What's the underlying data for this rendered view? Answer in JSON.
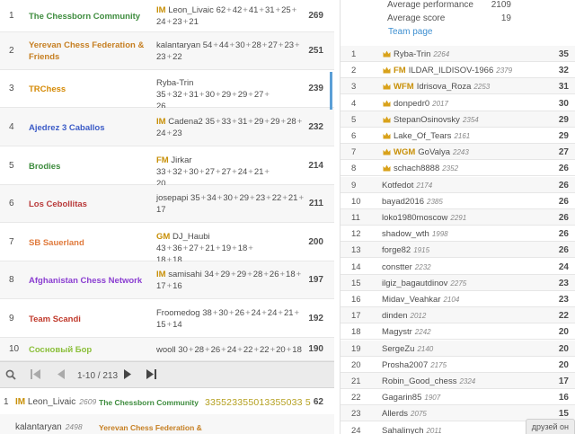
{
  "teams": [
    {
      "rank": "1",
      "name": "The Chessborn Community",
      "color": "#3e8c3e",
      "title": "IM",
      "player": "Leon_Livaic",
      "line1": [
        "62",
        "42",
        "41",
        "31",
        "25"
      ],
      "line2": [
        "24",
        "23",
        "21"
      ],
      "score": "269"
    },
    {
      "rank": "2",
      "name": "Yerevan Chess Federation & Friends",
      "color": "#c67f22",
      "title": "",
      "player": "kalantaryan",
      "line1": [
        "54",
        "44",
        "30",
        "28",
        "27",
        "23"
      ],
      "line2": [
        "23",
        "22"
      ],
      "score": "251"
    },
    {
      "rank": "3",
      "name": "TRChess",
      "color": "#d58a06",
      "title": "",
      "player": "Ryba-Trin",
      "line1": [
        "35",
        "32",
        "31",
        "30",
        "29",
        "29",
        "27"
      ],
      "line2": [
        "26"
      ],
      "score": "239"
    },
    {
      "rank": "4",
      "name": "Ajedrez 3 Caballos",
      "color": "#3b5bc7",
      "title": "IM",
      "player": "Cadena2",
      "line1": [
        "35",
        "33",
        "31",
        "29",
        "29",
        "28"
      ],
      "line2": [
        "24",
        "23"
      ],
      "score": "232"
    },
    {
      "rank": "5",
      "name": "Brodies",
      "color": "#3e8c3e",
      "title": "FM",
      "player": "Jirkar",
      "line1": [
        "33",
        "32",
        "30",
        "27",
        "27",
        "24",
        "21"
      ],
      "line2": [
        "20"
      ],
      "score": "214"
    },
    {
      "rank": "6",
      "name": "Los Cebollitas",
      "color": "#b93a3a",
      "title": "",
      "player": "josepapi",
      "line1": [
        "35",
        "34",
        "30",
        "29",
        "23",
        "22",
        "21"
      ],
      "line2": [
        "17"
      ],
      "score": "211"
    },
    {
      "rank": "7",
      "name": "SB Sauerland",
      "color": "#e07a3c",
      "title": "GM",
      "player": "DJ_Haubi",
      "line1": [
        "43",
        "36",
        "27",
        "21",
        "19",
        "18"
      ],
      "line2": [
        "18",
        "18"
      ],
      "score": "200"
    },
    {
      "rank": "8",
      "name": "Afghanistan Chess Network",
      "color": "#8a3dd1",
      "title": "IM",
      "player": "samisahi",
      "line1": [
        "34",
        "29",
        "29",
        "28",
        "26",
        "18"
      ],
      "line2": [
        "17",
        "16"
      ],
      "score": "197"
    },
    {
      "rank": "9",
      "name": "Team Scandi",
      "color": "#c0392b",
      "title": "",
      "player": "Froomedog",
      "line1": [
        "38",
        "30",
        "26",
        "24",
        "24",
        "21"
      ],
      "line2": [
        "15",
        "14"
      ],
      "score": "192"
    },
    {
      "rank": "10",
      "name": "Сосновый Бор",
      "color": "#8bbf3a",
      "title": "",
      "player": "wooll",
      "line1": [
        "30",
        "28",
        "26",
        "24",
        "22",
        "22",
        "20",
        "18"
      ],
      "line2": [],
      "score": "190"
    }
  ],
  "pager": {
    "range": "1-10 / 213"
  },
  "bottom_players": [
    {
      "rank": "1",
      "title": "IM",
      "name": "Leon_Livaic",
      "rating": "2609",
      "team": "The Chessborn Community",
      "team_color": "#3e8c3e",
      "sequence": "335523355013355033 5",
      "score": "62"
    },
    {
      "rank": "",
      "title": "",
      "name": "kalantaryan",
      "rating": "2498",
      "team": "Yerevan Chess Federation &",
      "team_color": "#c67f22",
      "sequence": "",
      "score": ""
    }
  ],
  "info": {
    "avg_perf_label": "Average performance",
    "avg_perf_value": "2109",
    "avg_score_label": "Average score",
    "avg_score_value": "19",
    "team_page_link": "Team page"
  },
  "leaderboard": [
    {
      "rank": "1",
      "star": true,
      "title": "",
      "name": "Ryba-Trin",
      "rating": "2264",
      "score": "35"
    },
    {
      "rank": "2",
      "star": true,
      "title": "FM",
      "name": "ILDAR_ILDISOV-1966",
      "rating": "2379",
      "score": "32"
    },
    {
      "rank": "3",
      "star": true,
      "title": "WFM",
      "name": "Idrisova_Roza",
      "rating": "2253",
      "score": "31"
    },
    {
      "rank": "4",
      "star": true,
      "title": "",
      "name": "donpedr0",
      "rating": "2017",
      "score": "30"
    },
    {
      "rank": "5",
      "star": true,
      "title": "",
      "name": "StepanOsinovsky",
      "rating": "2354",
      "score": "29"
    },
    {
      "rank": "6",
      "star": true,
      "title": "",
      "name": "Lake_Of_Tears",
      "rating": "2161",
      "score": "29"
    },
    {
      "rank": "7",
      "star": true,
      "title": "WGM",
      "name": "GoValya",
      "rating": "2243",
      "score": "27"
    },
    {
      "rank": "8",
      "star": true,
      "title": "",
      "name": "schach8888",
      "rating": "2352",
      "score": "26"
    },
    {
      "rank": "9",
      "star": false,
      "title": "",
      "name": "Kotfedot",
      "rating": "2174",
      "score": "26"
    },
    {
      "rank": "10",
      "star": false,
      "title": "",
      "name": "bayad2016",
      "rating": "2385",
      "score": "26"
    },
    {
      "rank": "11",
      "star": false,
      "title": "",
      "name": "loko1980moscow",
      "rating": "2291",
      "score": "26"
    },
    {
      "rank": "12",
      "star": false,
      "title": "",
      "name": "shadow_wth",
      "rating": "1998",
      "score": "26"
    },
    {
      "rank": "13",
      "star": false,
      "title": "",
      "name": "forge82",
      "rating": "1915",
      "score": "26"
    },
    {
      "rank": "14",
      "star": false,
      "title": "",
      "name": "constter",
      "rating": "2232",
      "score": "24"
    },
    {
      "rank": "15",
      "star": false,
      "title": "",
      "name": "ilgiz_bagautdinov",
      "rating": "2275",
      "score": "23"
    },
    {
      "rank": "16",
      "star": false,
      "title": "",
      "name": "Midav_Veahkar",
      "rating": "2104",
      "score": "23"
    },
    {
      "rank": "17",
      "star": false,
      "title": "",
      "name": "dinden",
      "rating": "2012",
      "score": "22"
    },
    {
      "rank": "18",
      "star": false,
      "title": "",
      "name": "Magystr",
      "rating": "2242",
      "score": "20"
    },
    {
      "rank": "19",
      "star": false,
      "title": "",
      "name": "SergeZu",
      "rating": "2140",
      "score": "20"
    },
    {
      "rank": "20",
      "star": false,
      "title": "",
      "name": "Prosha2007",
      "rating": "2175",
      "score": "20"
    },
    {
      "rank": "21",
      "star": false,
      "title": "",
      "name": "Robin_Good_chess",
      "rating": "2324",
      "score": "17"
    },
    {
      "rank": "22",
      "star": false,
      "title": "",
      "name": "Gagarin85",
      "rating": "1907",
      "score": "16"
    },
    {
      "rank": "23",
      "star": false,
      "title": "",
      "name": "Allerds",
      "rating": "2075",
      "score": "15"
    },
    {
      "rank": "24",
      "star": false,
      "title": "",
      "name": "Sahalinych",
      "rating": "2011",
      "score": ""
    }
  ],
  "friends_tab": "друзей он",
  "icons": {
    "search": "search-icon",
    "first": "first-page-icon",
    "prev": "prev-page-icon",
    "next": "next-page-icon",
    "last": "last-page-icon",
    "star": "star-icon"
  },
  "colors": {
    "title_gold": "#c89008",
    "link_blue": "#3d8fd1",
    "accent_blue": "#5b9fd6"
  }
}
